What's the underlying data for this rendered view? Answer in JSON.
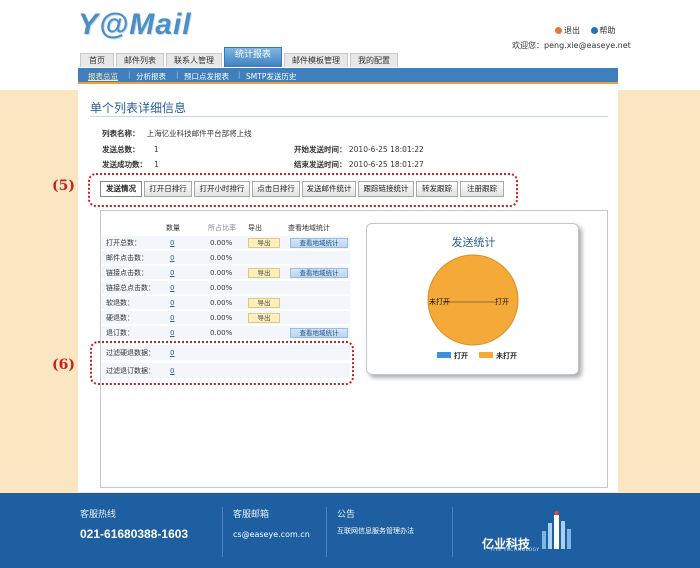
{
  "header": {
    "logo": "Y@Mail",
    "logout": "退出",
    "help": "帮助",
    "welcome": "欢迎您：peng.xie@easeye.net"
  },
  "nav": {
    "tabs": [
      "首页",
      "邮件列表",
      "联系人管理",
      "统计报表",
      "邮件模板管理",
      "我的配置"
    ],
    "active_tab": "统计报表",
    "subtabs": [
      "报表总览",
      "分析报表",
      "预口点发报表",
      "SMTP发送历史"
    ],
    "active_subtab": "报表总览"
  },
  "page": {
    "title": "单个列表详细信息",
    "list_name_label": "列表名称：",
    "list_name": "上海亿业科技邮件平台部将上线",
    "total_sent_label": "发送总数：",
    "total_sent": "1",
    "success_label": "发送成功数：",
    "success": "1",
    "start_label": "开始发送时间：",
    "start_time": "2010-6-25 18:01:22",
    "end_label": "结束发送时间：",
    "end_time": "2010-6-25 18:01:27"
  },
  "func_buttons": [
    "发送情况",
    "打开日排行",
    "打开小时排行",
    "点击日排行",
    "发送邮件统计",
    "跟踪链接统计",
    "转发跟踪",
    "注册跟踪"
  ],
  "annotations": {
    "a5": "(5)",
    "a6": "(6)"
  },
  "stats_table": {
    "headers": {
      "count": "数量",
      "ratio": "所占比率",
      "export": "导出",
      "geo": "查看地域统计"
    },
    "export_label": "导出",
    "geo_label": "查看地域统计",
    "rows": [
      {
        "label": "打开总数：",
        "count": "0",
        "ratio": "0.00%"
      },
      {
        "label": "邮件点击数：",
        "count": "0",
        "ratio": "0.00%"
      },
      {
        "label": "链接点击数：",
        "count": "0",
        "ratio": "0.00%"
      },
      {
        "label": "链接总点击数：",
        "count": "0",
        "ratio": "0.00%"
      },
      {
        "label": "软退数：",
        "count": "0",
        "ratio": "0.00%"
      },
      {
        "label": "硬退数：",
        "count": "0",
        "ratio": "0.00%"
      },
      {
        "label": "退订数：",
        "count": "0",
        "ratio": "0.00%"
      },
      {
        "label": "过滤硬退数据：",
        "count": "0"
      },
      {
        "label": "过滤退订数据：",
        "count": "0"
      }
    ]
  },
  "chart_data": {
    "type": "pie",
    "title": "发送统计",
    "categories": [
      "打开",
      "未打开"
    ],
    "values": [
      0,
      1
    ],
    "labels": [
      "未打开",
      "打开"
    ],
    "legend": "bottom",
    "colors": [
      "#3f8fd9",
      "#f5a938"
    ]
  },
  "footer": {
    "hotline_title": "客服热线",
    "hotline": "021-61680388-1603",
    "email_title": "客服邮箱",
    "email": "cs@easeye.com.cn",
    "notice_title": "公告",
    "notice": "互联网信息服务管理办法",
    "brand": "亿业科技",
    "brand_en": "YIYE TECHNOLOGY"
  }
}
